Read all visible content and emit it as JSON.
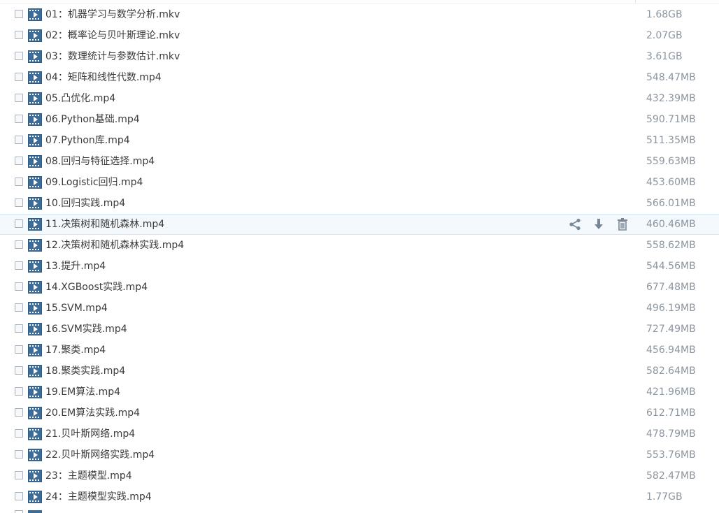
{
  "files": [
    {
      "name": "01：机器学习与数学分析.mkv",
      "size": "1.68GB"
    },
    {
      "name": "02：概率论与贝叶斯理论.mkv",
      "size": "2.07GB"
    },
    {
      "name": "03：数理统计与参数估计.mkv",
      "size": "3.61GB"
    },
    {
      "name": "04：矩阵和线性代数.mp4",
      "size": "548.47MB"
    },
    {
      "name": "05.凸优化.mp4",
      "size": "432.39MB"
    },
    {
      "name": "06.Python基础.mp4",
      "size": "590.71MB"
    },
    {
      "name": "07.Python库.mp4",
      "size": "511.35MB"
    },
    {
      "name": "08.回归与特征选择.mp4",
      "size": "559.63MB"
    },
    {
      "name": "09.Logistic回归.mp4",
      "size": "453.60MB"
    },
    {
      "name": "10.回归实践.mp4",
      "size": "566.01MB"
    },
    {
      "name": "11.决策树和随机森林.mp4",
      "size": "460.46MB",
      "hovered": true
    },
    {
      "name": "12.决策树和随机森林实践.mp4",
      "size": "558.62MB"
    },
    {
      "name": "13.提升.mp4",
      "size": "544.56MB"
    },
    {
      "name": "14.XGBoost实践.mp4",
      "size": "677.48MB"
    },
    {
      "name": "15.SVM.mp4",
      "size": "496.19MB"
    },
    {
      "name": "16.SVM实践.mp4",
      "size": "727.49MB"
    },
    {
      "name": "17.聚类.mp4",
      "size": "456.94MB"
    },
    {
      "name": "18.聚类实践.mp4",
      "size": "582.64MB"
    },
    {
      "name": "19.EM算法.mp4",
      "size": "421.96MB"
    },
    {
      "name": "20.EM算法实践.mp4",
      "size": "612.71MB"
    },
    {
      "name": "21.贝叶斯网络.mp4",
      "size": "478.79MB"
    },
    {
      "name": "22.贝叶斯网络实践.mp4",
      "size": "553.76MB"
    },
    {
      "name": "23：主题模型.mp4",
      "size": "582.47MB"
    },
    {
      "name": "24：主题模型实践.mp4",
      "size": "1.77GB"
    }
  ],
  "row_actions": [
    "share-icon",
    "download-icon",
    "trash-icon"
  ],
  "colors": {
    "icon_blue": "#3c6d99",
    "action_gray": "#7a8896",
    "size_gray": "#8c96a0",
    "hover_bg": "#f4f9fd",
    "hover_border": "#d2e8f7"
  }
}
